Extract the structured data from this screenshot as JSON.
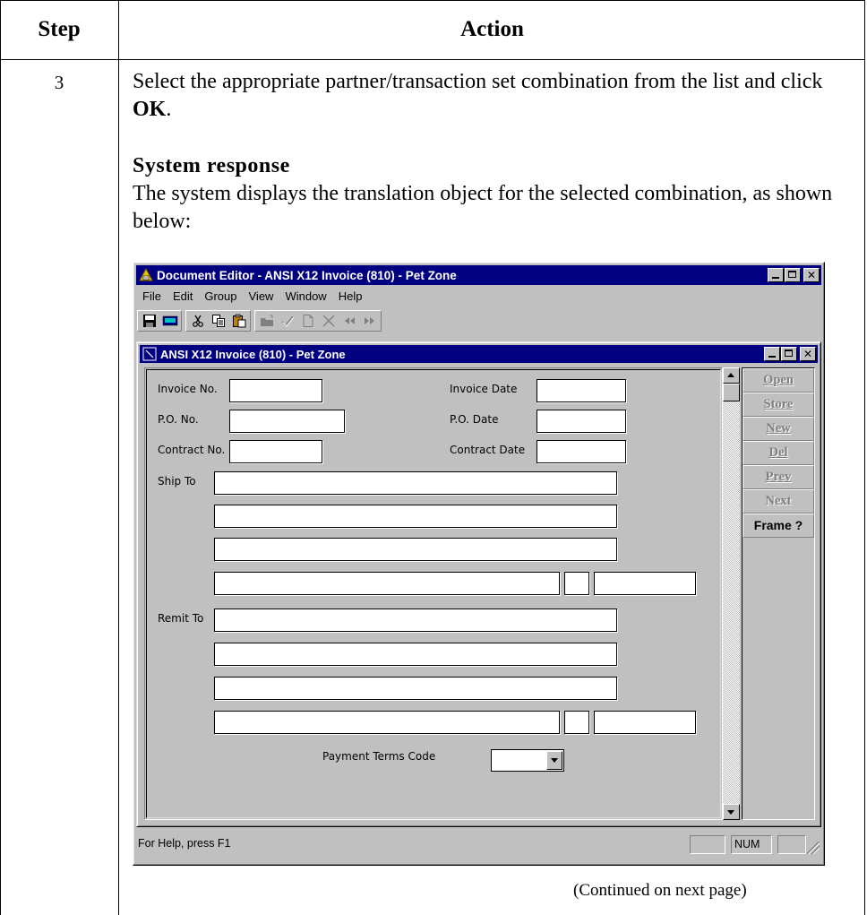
{
  "table": {
    "header_step": "Step",
    "header_action": "Action",
    "step_number": "3",
    "instruction_pre": "Select the appropriate partner/transaction set combination from the list and click ",
    "instruction_bold": "OK",
    "instruction_post": ".",
    "response_heading": "System response",
    "response_text": "The system displays the translation object for the selected combination, as shown below:",
    "continued": "(Continued on next page)"
  },
  "window": {
    "title": "Document Editor - ANSI X12 Invoice (810) - Pet Zone",
    "menu": [
      "File",
      "Edit",
      "Group",
      "View",
      "Window",
      "Help"
    ],
    "toolbar_icons": [
      "save-icon",
      "keyboard-icon",
      "cut-icon",
      "copy-icon",
      "paste-icon",
      "open-folder-icon",
      "check-icon",
      "new-doc-icon",
      "delete-x-icon",
      "rewind-icon",
      "fast-forward-icon"
    ],
    "child_title": "ANSI X12 Invoice (810) - Pet Zone",
    "status_text": "For Help, press F1",
    "status_num": "NUM"
  },
  "form": {
    "invoice_no_label": "Invoice No.",
    "invoice_date_label": "Invoice Date",
    "po_no_label": "P.O. No.",
    "po_date_label": "P.O. Date",
    "contract_no_label": "Contract No.",
    "contract_date_label": "Contract Date",
    "ship_to_label": "Ship To",
    "remit_to_label": "Remit To",
    "payment_terms_label": "Payment Terms Code"
  },
  "side_buttons": [
    {
      "label": "Open",
      "enabled": false
    },
    {
      "label": "Store",
      "enabled": false
    },
    {
      "label": "New",
      "enabled": false
    },
    {
      "label": "Del",
      "enabled": false
    },
    {
      "label": "Prev",
      "enabled": false
    },
    {
      "label": "Next",
      "enabled": false
    },
    {
      "label": "Frame ?",
      "enabled": true
    }
  ]
}
